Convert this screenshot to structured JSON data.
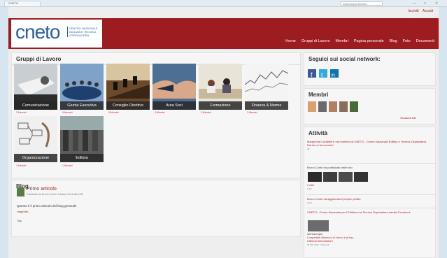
{
  "browser": {
    "tab_title": "CNETO",
    "address": "www.gruppi.it/cneto"
  },
  "header": {
    "top_links": [
      "Iscriviti",
      "Accedi"
    ],
    "logo_word": "cneto",
    "logo_sub": "Centro Nazionale Edilizia e Tecnica Ospedaliera",
    "nav": [
      "Home",
      "Gruppi di Lavoro",
      "Membri",
      "Pagina personale",
      "Blog",
      "Foto",
      "Documenti"
    ]
  },
  "groups": {
    "title": "Gruppi di Lavoro",
    "tiles": [
      {
        "label": "Comunicazione",
        "count": "2 Membri"
      },
      {
        "label": "Giunta Esecutiva",
        "count": "9 Membri"
      },
      {
        "label": "Consiglio Direttivo",
        "count": "3 Membri"
      },
      {
        "label": "Area Soci",
        "count": "3 Membri"
      },
      {
        "label": "Formazione",
        "count": "3 Membri"
      },
      {
        "label": "Finanza & Norme",
        "count": "1 Membri"
      },
      {
        "label": "Organizzazione",
        "count": "1 Membri"
      },
      {
        "label": "Edilizia",
        "count": "1 Membri"
      }
    ]
  },
  "blog": {
    "title": "Blog",
    "post_title": "Primo articolo",
    "meta": "Pubblicato da Bruno Conte 12 Marzo 2014 alle 9:08",
    "text": "Questo è il primo articolo del blog generale",
    "read_more": "Leggi tutto...",
    "tags": "Tag:"
  },
  "social": {
    "title": "Seguici sui social network:",
    "icons": [
      "facebook-icon",
      "twitter-icon",
      "linkedin-icon"
    ]
  },
  "members": {
    "title": "Membri",
    "view_all": "Visualizza tutti"
  },
  "activity": {
    "title": "Attività",
    "items": [
      {
        "text": "Margherita Carabelli è ora membro di CNETO - Centro Nazionale Edilizia e Tecnica Ospedaliera",
        "sub": "Dai loro il benvenuto!",
        "time": "40"
      },
      {
        "text": "Bruno Conte ha pubblicato delle foto",
        "sub": "2 altri",
        "time": "2 Apr"
      },
      {
        "text": "Bruno Conte ha aggiornato il proprio profilo",
        "sub": "",
        "time": "2 Apr"
      },
      {
        "text": "CNETO - Centro Nazionale per l'Edilizia e la Tecnica Ospedaliera tramite Facebook",
        "sub": "dell'esempio",
        "time": "L'ospedale Manzoni di Lecco è al top...",
        "extra": "Ulteriori informazioni",
        "date": "28 Mar 2013 · Rispondi"
      }
    ]
  }
}
